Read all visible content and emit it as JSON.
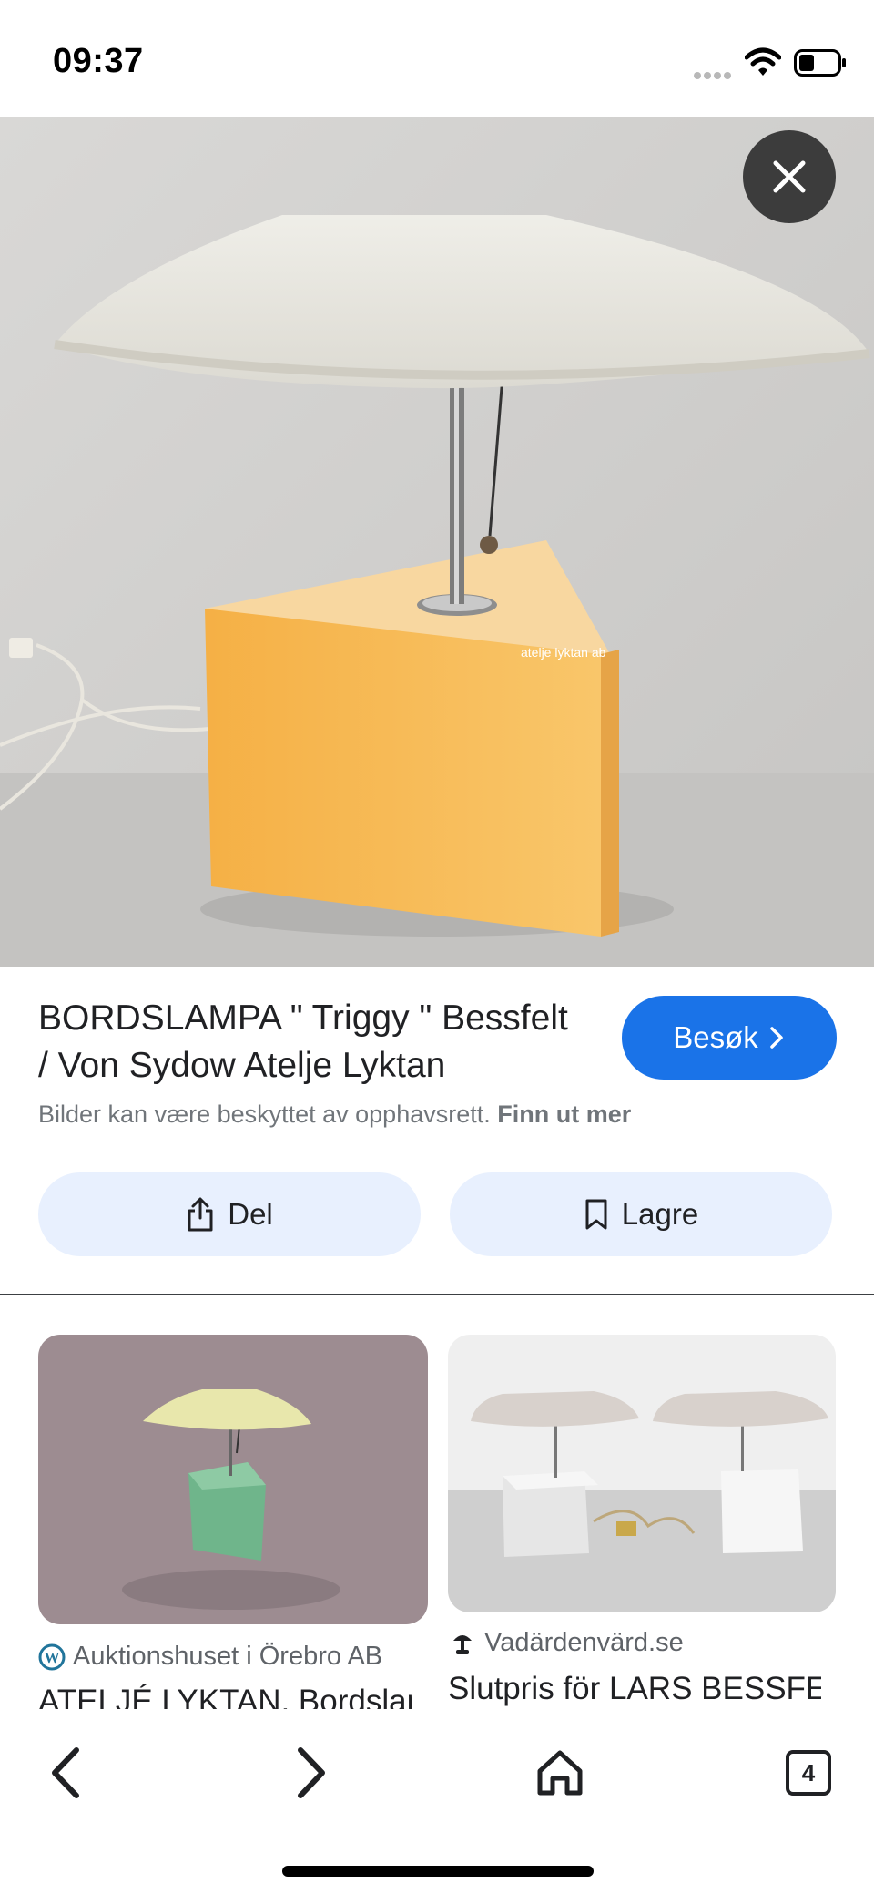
{
  "status_bar": {
    "time": "09:37"
  },
  "result": {
    "title": "BORDSLAMPA \" Triggy \" Bessfelt / Von Sydow Atelje Lyktan",
    "visit_label": "Besøk",
    "copyright_text": "Bilder kan være beskyttet av opphavsrett.",
    "learn_more_label": "Finn ut mer",
    "brand_mark": "atelje lyktan ab"
  },
  "actions": {
    "share_label": "Del",
    "save_label": "Lagre"
  },
  "related": [
    {
      "source": "Auktionshuset i Örebro AB",
      "title": "ATELJÉ LYKTAN, Bordslampa",
      "favicon": "wordpress-icon"
    },
    {
      "source": "Vadärdenvärd.se",
      "title": "Slutpris för LARS BESSFELT",
      "favicon": "lamp-icon"
    }
  ],
  "toolbar": {
    "tabs_count": "4"
  },
  "colors": {
    "accent": "#1a73e8",
    "pill_bg": "#e8f0fe",
    "lamp_base": "#f6b94f"
  }
}
